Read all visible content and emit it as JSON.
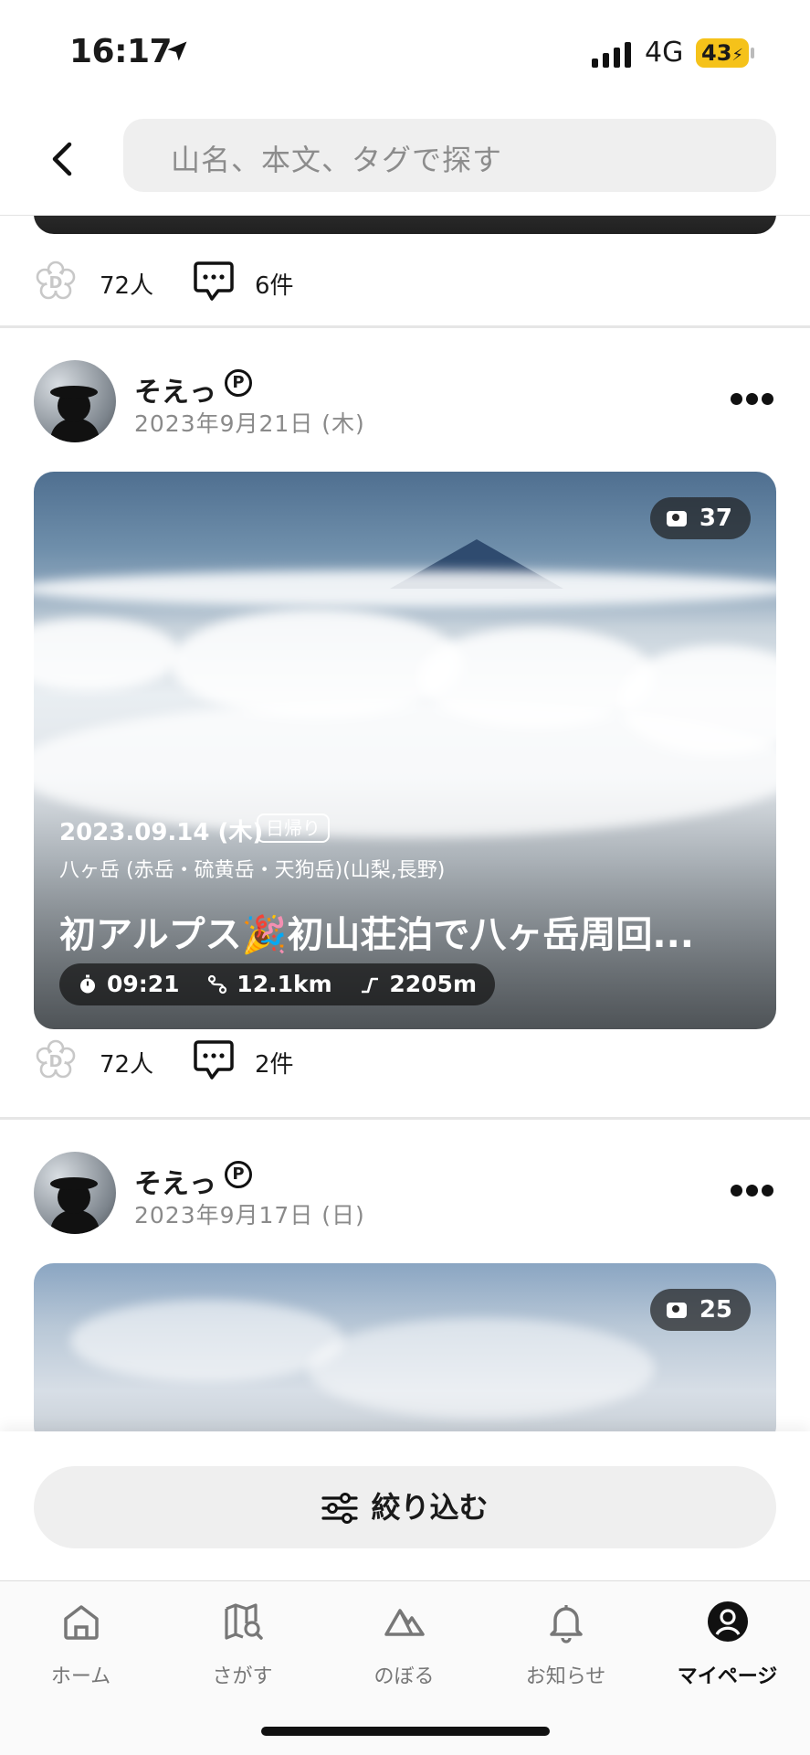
{
  "status_bar": {
    "time": "16:17",
    "network": "4G",
    "battery": "43"
  },
  "search": {
    "placeholder": "山名、本文、タグで探す"
  },
  "previous_post": {
    "likes": "72人",
    "comments": "6件"
  },
  "posts": [
    {
      "user": "そえっ",
      "badge": "P",
      "date": "2023年9月21日 (木)",
      "photo_count": "37",
      "activity_date": "2023.09.14 (木)",
      "trip_type": "日帰り",
      "mountains": "八ヶ岳 (赤岳・硫黄岳・天狗岳)(山梨,長野)",
      "title": "初アルプス🎉初山荘泊で八ヶ岳周回...",
      "stats": {
        "time": "09:21",
        "distance": "12.1km",
        "elevation": "2205m"
      },
      "likes": "72人",
      "comments": "2件"
    },
    {
      "user": "そえっ",
      "badge": "P",
      "date": "2023年9月17日 (日)",
      "photo_count": "25"
    }
  ],
  "filter": {
    "label": "絞り込む"
  },
  "tabs": [
    {
      "label": "ホーム",
      "icon": "home-icon"
    },
    {
      "label": "さがす",
      "icon": "map-search-icon"
    },
    {
      "label": "のぼる",
      "icon": "mountain-icon"
    },
    {
      "label": "お知らせ",
      "icon": "bell-icon"
    },
    {
      "label": "マイページ",
      "icon": "person-icon",
      "active": true
    }
  ],
  "colors": {
    "battery": "#f5c21a",
    "text": "#1a1a1a",
    "muted": "#8a8a8a",
    "button_bg": "#efefef"
  }
}
